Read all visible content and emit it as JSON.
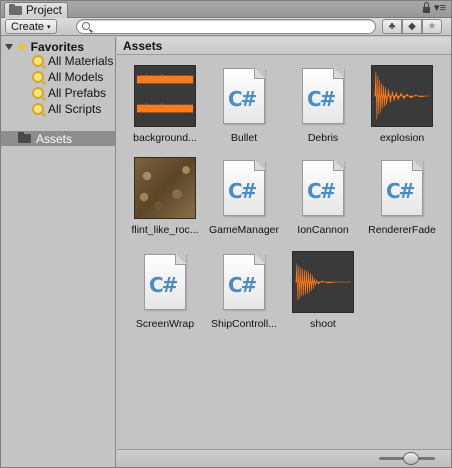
{
  "window": {
    "tab_title": "Project",
    "tab_menu_glyph": "▾≡"
  },
  "toolbar": {
    "create_label": "Create",
    "create_caret": "▾",
    "search_value": "",
    "search_placeholder": "",
    "btn_types_glyph": "♣",
    "btn_labels_glyph": "◆",
    "btn_favorite_glyph": "★"
  },
  "sidebar": {
    "favorites_label": "Favorites",
    "favorites_items": [
      {
        "label": "All Materials"
      },
      {
        "label": "All Models"
      },
      {
        "label": "All Prefabs"
      },
      {
        "label": "All Scripts"
      }
    ],
    "assets_label": "Assets"
  },
  "main": {
    "header_title": "Assets",
    "items": [
      {
        "label": "background...",
        "kind": "audio"
      },
      {
        "label": "Bullet",
        "kind": "script"
      },
      {
        "label": "Debris",
        "kind": "script"
      },
      {
        "label": "explosion",
        "kind": "audio"
      },
      {
        "label": "flint_like_roc...",
        "kind": "texture"
      },
      {
        "label": "GameManager",
        "kind": "script"
      },
      {
        "label": "IonCannon",
        "kind": "script"
      },
      {
        "label": "RendererFade",
        "kind": "script"
      },
      {
        "label": "ScreenWrap",
        "kind": "script"
      },
      {
        "label": "ShipControll...",
        "kind": "script"
      },
      {
        "label": "shoot",
        "kind": "audio"
      }
    ],
    "script_glyph": "C#"
  },
  "colors": {
    "waveform": "#ff7a1a",
    "selection": "#8e8e8e",
    "script_text": "#4a8cc7",
    "favorites_star": "#f1c21b"
  }
}
